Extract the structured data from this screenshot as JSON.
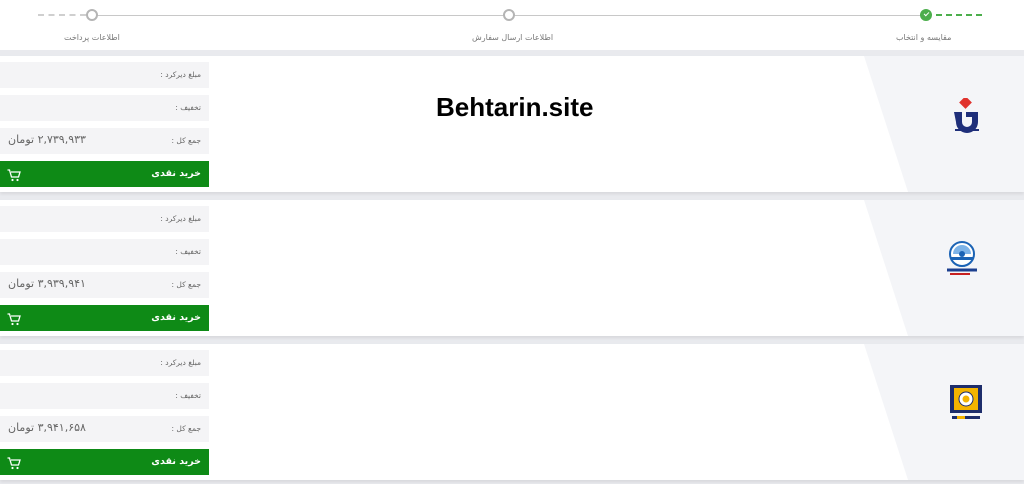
{
  "stepper": {
    "steps": [
      {
        "label": "مقایسه و انتخاب",
        "state": "done"
      },
      {
        "label": "اطلاعات ارسال سفارش",
        "state": "pending"
      },
      {
        "label": "اطلاعات پرداخت",
        "state": "pending"
      }
    ],
    "accent": "#4cae4c"
  },
  "watermark": "Behtarin.site",
  "labels": {
    "amount": "مبلغ دیرکرد :",
    "discount": "تخفیف :",
    "total": "جمع کل :",
    "buy": "خرید نقدی"
  },
  "offers": [
    {
      "company_logo": "bimeh-dana-logo",
      "total": "۲,۷۳۹,۹۳۳ تومان"
    },
    {
      "company_logo": "bimeh-iran-logo",
      "total": "۳,۹۳۹,۹۴۱ تومان"
    },
    {
      "company_logo": "bimeh-pasargad-logo",
      "total": "۳,۹۴۱,۶۵۸ تومان"
    }
  ],
  "colors": {
    "buy_button": "#0e8a16",
    "dana": "#1f2f7a",
    "dana_red": "#e0322d",
    "pasargad": "#1d2d6b",
    "pasargad_sun": "#f4b400"
  }
}
